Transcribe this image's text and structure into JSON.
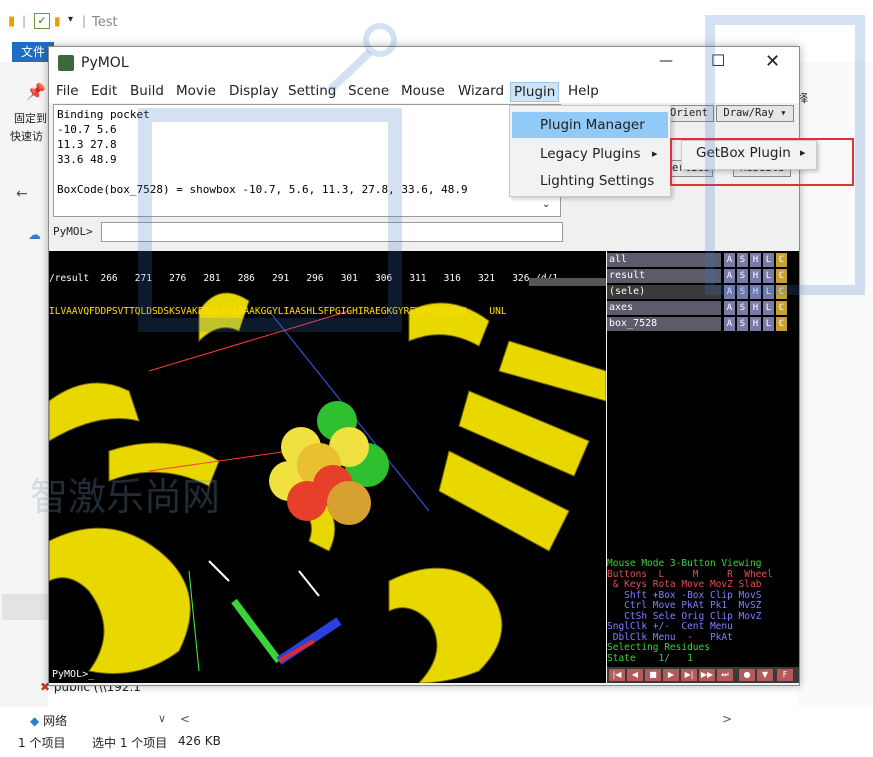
{
  "explorer": {
    "path_title": "Test",
    "ribbon_tab": "文件",
    "side_label_1": "固定到",
    "side_label_2": "快速访",
    "network_label": "网络",
    "public_label": "public (\\\\192.1",
    "status_count": "1 个项目",
    "status_selected": "选中 1 个项目",
    "status_size": "426 KB",
    "right_label": "择"
  },
  "pymol": {
    "title": "PyMOL",
    "menu": [
      "File",
      "Edit",
      "Build",
      "Movie",
      "Display",
      "Setting",
      "Scene",
      "Mouse",
      "Wizard",
      "Plugin",
      "Help"
    ],
    "output_lines": [
      "Binding pocket",
      "-10.7 5.6",
      "11.3 27.8",
      "33.6 48.9",
      "",
      "BoxCode(box_7528) = showbox -10.7, 5.6, 11.3, 27.8, 33.6, 48.9"
    ],
    "cmd_prompt": "PyMOL>",
    "buttons": {
      "orient": "Orient",
      "draw_ray": "Draw/Ray ▾",
      "rebuild": "Rebuild",
      "properties": "erties"
    },
    "seq_header": "/result  266   271   276   281   286   291   296   301   306   311   316   321   326 /d/1",
    "seq_residues": "ILVAAVQFDDPSVTTQLDSDSKSVAKERKKAFADAAKGGYLIAASHLSFPGIGHIRAEGKGYRFVPVNYSVVN    UNL",
    "objects": [
      {
        "name": "all"
      },
      {
        "name": "result"
      },
      {
        "name": "(sele)"
      },
      {
        "name": "axes"
      },
      {
        "name": "box_7528"
      }
    ],
    "obj_buttons": [
      "A",
      "S",
      "H",
      "L",
      "C"
    ],
    "mouse_mode_lines": [
      "Mouse Mode 3-Button Viewing",
      "Buttons  L     M     R  Wheel",
      " & Keys Rota Move MovZ Slab",
      "   Shft +Box -Box Clip MovS",
      "   Ctrl Move PkAt Pk1  MvSZ",
      "   CtSh Sele Orig Clip MovZ",
      "SnglClk +/-  Cent Menu",
      " DblClk Menu  -   PkAt",
      "Selecting Residues",
      "State    1/   1"
    ],
    "viewer_prompt": "PyMOL>_"
  },
  "plugin_menu": {
    "items": [
      "Plugin Manager",
      "Legacy Plugins",
      "Lighting Settings"
    ],
    "submenu_item": "GetBox Plugin",
    "arrow": "▸"
  },
  "colors": {
    "accent": "#1e6fc3",
    "menu_highlight": "#91c9f7",
    "highlight_box": "#e0303a",
    "cartoon": "#e8d800",
    "obj_button": "#7a7aa8"
  },
  "watermark_text": "智激乐尚网"
}
